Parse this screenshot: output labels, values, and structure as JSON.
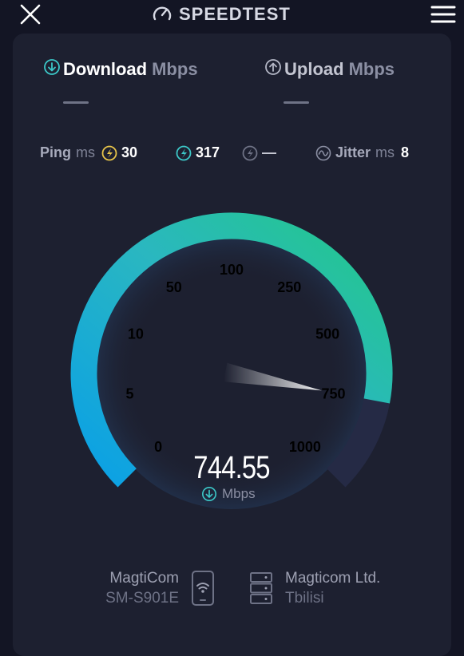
{
  "header": {
    "title": "SPEEDTEST",
    "close_icon": "close-icon",
    "menu_icon": "hamburger-menu-icon",
    "logo_icon": "speedometer-icon"
  },
  "tabs": {
    "download": {
      "label": "Download",
      "unit": "Mbps",
      "icon": "download-arrow-icon"
    },
    "upload": {
      "label": "Upload",
      "unit": "Mbps",
      "icon": "upload-arrow-icon"
    }
  },
  "stats": {
    "ping_label": "Ping",
    "ping_unit": "ms",
    "ping_idle": "30",
    "ping_download": "317",
    "ping_upload": "—",
    "jitter_label": "Jitter",
    "jitter_unit": "ms",
    "jitter_value": "8"
  },
  "gauge": {
    "labels": [
      "0",
      "5",
      "10",
      "50",
      "100",
      "250",
      "500",
      "750",
      "1000"
    ],
    "value": "744.55",
    "unit": "Mbps",
    "fill_fraction": 0.873,
    "colors": {
      "start": "#0aa0e6",
      "mid": "#2ab7c0",
      "end": "#23c88a",
      "track": "#252a45"
    }
  },
  "footer": {
    "provider": "MagtiCom",
    "device": "SM-S901E",
    "server_name": "Magticom Ltd.",
    "server_city": "Tbilisi",
    "device_icon": "phone-wifi-icon",
    "server_icon": "server-icon"
  }
}
